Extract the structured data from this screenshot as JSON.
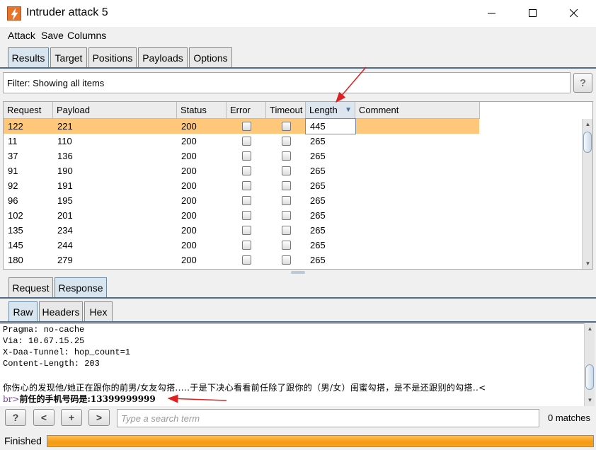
{
  "window": {
    "title": "Intruder attack 5",
    "minimize_glyph": "—",
    "maximize_glyph": "☐",
    "close_glyph": "✕"
  },
  "menu": [
    "Attack",
    "Save",
    "Columns"
  ],
  "main_tabs": {
    "items": [
      "Results",
      "Target",
      "Positions",
      "Payloads",
      "Options"
    ],
    "active": "Results"
  },
  "filter": {
    "text": "Filter: Showing all items",
    "help_label": "?"
  },
  "results_table": {
    "columns": [
      "Request",
      "Payload",
      "Status",
      "Error",
      "Timeout",
      "Length",
      "Comment"
    ],
    "sorted_by": "Length",
    "sort_icon": "sort-descending-icon",
    "selected_row": 0,
    "rows": [
      {
        "request": "122",
        "payload": "221",
        "status": "200",
        "error": false,
        "timeout": false,
        "length": "445",
        "comment": ""
      },
      {
        "request": "11",
        "payload": "110",
        "status": "200",
        "error": false,
        "timeout": false,
        "length": "265",
        "comment": ""
      },
      {
        "request": "37",
        "payload": "136",
        "status": "200",
        "error": false,
        "timeout": false,
        "length": "265",
        "comment": ""
      },
      {
        "request": "91",
        "payload": "190",
        "status": "200",
        "error": false,
        "timeout": false,
        "length": "265",
        "comment": ""
      },
      {
        "request": "92",
        "payload": "191",
        "status": "200",
        "error": false,
        "timeout": false,
        "length": "265",
        "comment": ""
      },
      {
        "request": "96",
        "payload": "195",
        "status": "200",
        "error": false,
        "timeout": false,
        "length": "265",
        "comment": ""
      },
      {
        "request": "102",
        "payload": "201",
        "status": "200",
        "error": false,
        "timeout": false,
        "length": "265",
        "comment": ""
      },
      {
        "request": "135",
        "payload": "234",
        "status": "200",
        "error": false,
        "timeout": false,
        "length": "265",
        "comment": ""
      },
      {
        "request": "145",
        "payload": "244",
        "status": "200",
        "error": false,
        "timeout": false,
        "length": "265",
        "comment": ""
      },
      {
        "request": "180",
        "payload": "279",
        "status": "200",
        "error": false,
        "timeout": false,
        "length": "265",
        "comment": ""
      }
    ]
  },
  "message_tabs": {
    "items": [
      "Request",
      "Response"
    ],
    "active": "Response"
  },
  "view_tabs": {
    "items": [
      "Raw",
      "Headers",
      "Hex"
    ],
    "active": "Raw"
  },
  "response": {
    "headers": [
      "Pragma: no-cache",
      "Via: 10.67.15.25",
      "X-Daa-Tunnel: hop_count=1",
      "Content-Length: 203"
    ],
    "body_line1": "你伤心的发现他/她正在跟你的前男/女友勾搭.....于是下决心看看前任除了跟你的（男/女）闺蜜勾搭，是不是还跟别的勾搭..<",
    "body_tag": "br>",
    "body_line2": "前任的手机号码是:13399999999"
  },
  "search": {
    "help_label": "?",
    "prev_label": "<",
    "add_label": "+",
    "next_label": ">",
    "placeholder": "Type a search term",
    "matches": "0 matches"
  },
  "status": {
    "text": "Finished",
    "progress_percent": 100,
    "progress_color": "#f7a524"
  },
  "colors": {
    "selected_row": "#ffc77a",
    "annotation_arrow": "#e02020",
    "tab_active": "#d8e4ee"
  }
}
